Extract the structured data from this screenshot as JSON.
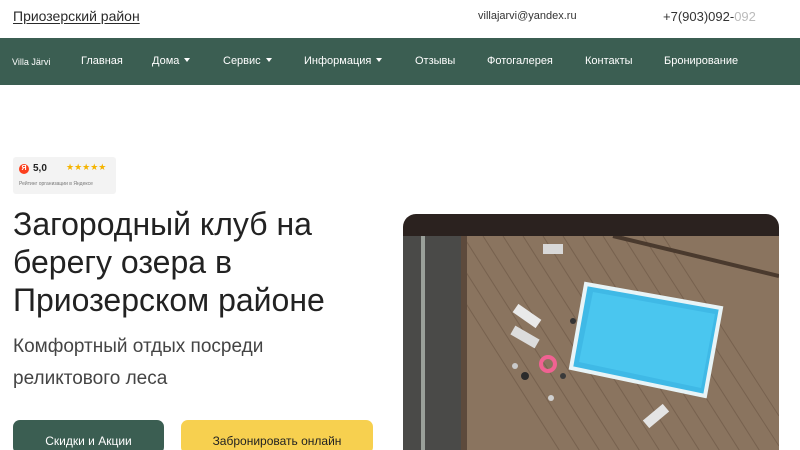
{
  "topbar": {
    "region_link": "Приозерский район",
    "email": "villajarvi@yandex.ru",
    "phone_main": "+7(903)092-",
    "phone_fade": "092"
  },
  "nav": {
    "brand": "Villa Järvi",
    "items": [
      {
        "label": "Главная",
        "dropdown": false
      },
      {
        "label": "Дома",
        "dropdown": true
      },
      {
        "label": "Сервис",
        "dropdown": true
      },
      {
        "label": "Информация",
        "dropdown": true
      },
      {
        "label": "Отзывы",
        "dropdown": false
      },
      {
        "label": "Фотогалерея",
        "dropdown": false
      },
      {
        "label": "Контакты",
        "dropdown": false
      },
      {
        "label": "Бронирование",
        "dropdown": false
      }
    ],
    "bg_color": "#3b5e52"
  },
  "rating": {
    "icon": "yandex-icon",
    "icon_letter": "Я",
    "value": "5,0",
    "stars": "★★★★★",
    "caption": "Рейтинг организации в Яндексе"
  },
  "hero": {
    "title": "Загородный клуб на берегу озера в Приозерском районе",
    "subtitle": "Комфортный отдых посреди реликтового леса",
    "btn_sales": "Скидки и Акции",
    "btn_book": "Забронировать онлайн",
    "accent_yellow": "#f7d04f"
  }
}
